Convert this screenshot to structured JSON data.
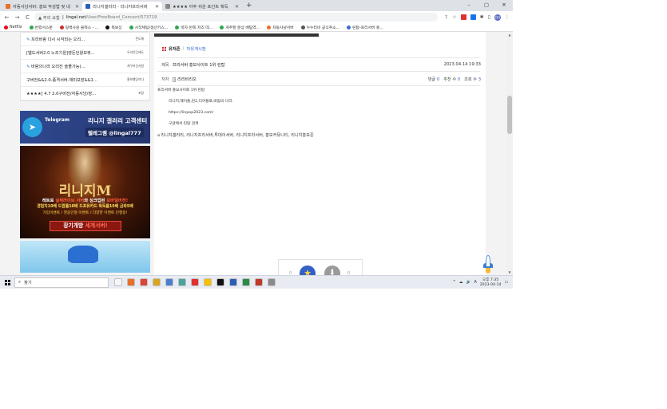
{
  "browser": {
    "tabs": [
      {
        "title": "자동사냥서버: 홍보 작성법 및 네",
        "active": false,
        "color": "#e8702a"
      },
      {
        "title": "리니지갤러리 - 리니지프리서버",
        "active": true,
        "color": "#2b5fb6"
      },
      {
        "title": "★★★★ 아주 쉬운 포인트 획득",
        "active": false,
        "color": "#888888"
      }
    ],
    "new_tab": "+",
    "window_controls": [
      "–",
      "▢",
      "✕"
    ],
    "nav": {
      "back": "←",
      "forward": "→",
      "reload": "C"
    },
    "address": {
      "warning": "▲ 주의 요함",
      "host": "lingal.net",
      "path": "/User/FreeBoard_Concent/573719"
    },
    "profile_initials": "인다"
  },
  "bookmarks": [
    {
      "label": "Netflix",
      "color": "#e50914"
    },
    {
      "label": "반령서스문",
      "color": "#2da94f"
    },
    {
      "label": "핑백사원 블랙스 - ...",
      "color": "#c9302c"
    },
    {
      "label": "독보상",
      "color": "#111111"
    },
    {
      "label": "시작채팅/생선키스...",
      "color": "#2da94f"
    },
    {
      "label": "넣자 반쪽 저즈 데...",
      "color": "#2da94f"
    },
    {
      "label": "게주할 분상 배팀역...",
      "color": "#2da94f"
    },
    {
      "label": "자동사냥서버",
      "color": "#e8702a"
    },
    {
      "label": "누누티비 공식주소...",
      "color": "#555555"
    },
    {
      "label": "린탑-프리서버 홍...",
      "color": "#3a6ed1"
    }
  ],
  "sidebar": {
    "items": [
      {
        "title": "프리바람 다시 시작되는 오리...",
        "badge": "돈도해",
        "pen": true
      },
      {
        "title": "[엘도서버2.0 노조기원]영돈던왕보뷰...",
        "badge": "우리인단에도",
        "pen": false
      },
      {
        "title": "바람의나라 오리진 솔플가능(...",
        "badge": "게구리선사람",
        "pen": true
      },
      {
        "title": "구버전&&2.0-종격서버-재미보장&&1...",
        "badge": "홍보행당이다",
        "pen": false
      },
      {
        "title": "★★★★[ 4.7 2.0구버전/자동사냥/장...",
        "badge": "포랑",
        "pen": false
      }
    ],
    "telegram": {
      "brand": "Telegram",
      "title": "리니지 갤러리 고객센터",
      "handle": "텔레그램 @lingal777"
    },
    "lineage_banner": {
      "title": "리니지M",
      "line1a": "레트로 ",
      "line1b": "실제라이브 서버",
      "line1c": "와 싱크업된 ",
      "line1d": "모바일버전!",
      "line2": "경험치10배 드랍률10배 드포유카드 획득률10배 금화5배",
      "line3": "가입이벤트 / 영웅인형 이벤트 / 다양한 이벤트 진행중!",
      "button_a": "장기개방 ",
      "button_b": "세계서버!"
    }
  },
  "post": {
    "board_name": "유저존",
    "board_sub": "자유게시판",
    "subject_label": "제목",
    "subject": "프리서버 홍보사이트 1위 린탑",
    "date": "2023.04.14 19:33",
    "author_label": "저자",
    "level_badge": "1",
    "author": "리리비리오",
    "stats": [
      {
        "label": "댓글",
        "value": "0"
      },
      {
        "label": "추천 수",
        "value": "0"
      },
      {
        "label": "조회 수",
        "value": "3"
      }
    ],
    "body": [
      "프리서버 홍보사이트 1위 린탑",
      "리니지,메이플,린2,디아블로,바람의 나라.",
      "https://linpop2023.com/",
      "구글에서 린탑 검색"
    ],
    "tags": "리니지갤러리, 리니지프리서버,투데이서버, 리니지프리서버, 홍보커뮤니티, 리니지홍보존",
    "vote_up": "0",
    "vote_down": "0"
  },
  "taskbar": {
    "search_placeholder": "찾기",
    "app_colors": [
      "#f7f7f7",
      "#e8702a",
      "#db4437",
      "#d9a520",
      "#4a7fcf",
      "#4aa3a0",
      "#e03030",
      "#f6c000",
      "#111111",
      "#2b5fb6",
      "#2a8a46",
      "#c0392b",
      "#8a8a8a"
    ],
    "tray_icons": [
      "^",
      "☁",
      "🔊",
      "A"
    ],
    "time": "오후 7:35",
    "date": "2023-04-14"
  }
}
